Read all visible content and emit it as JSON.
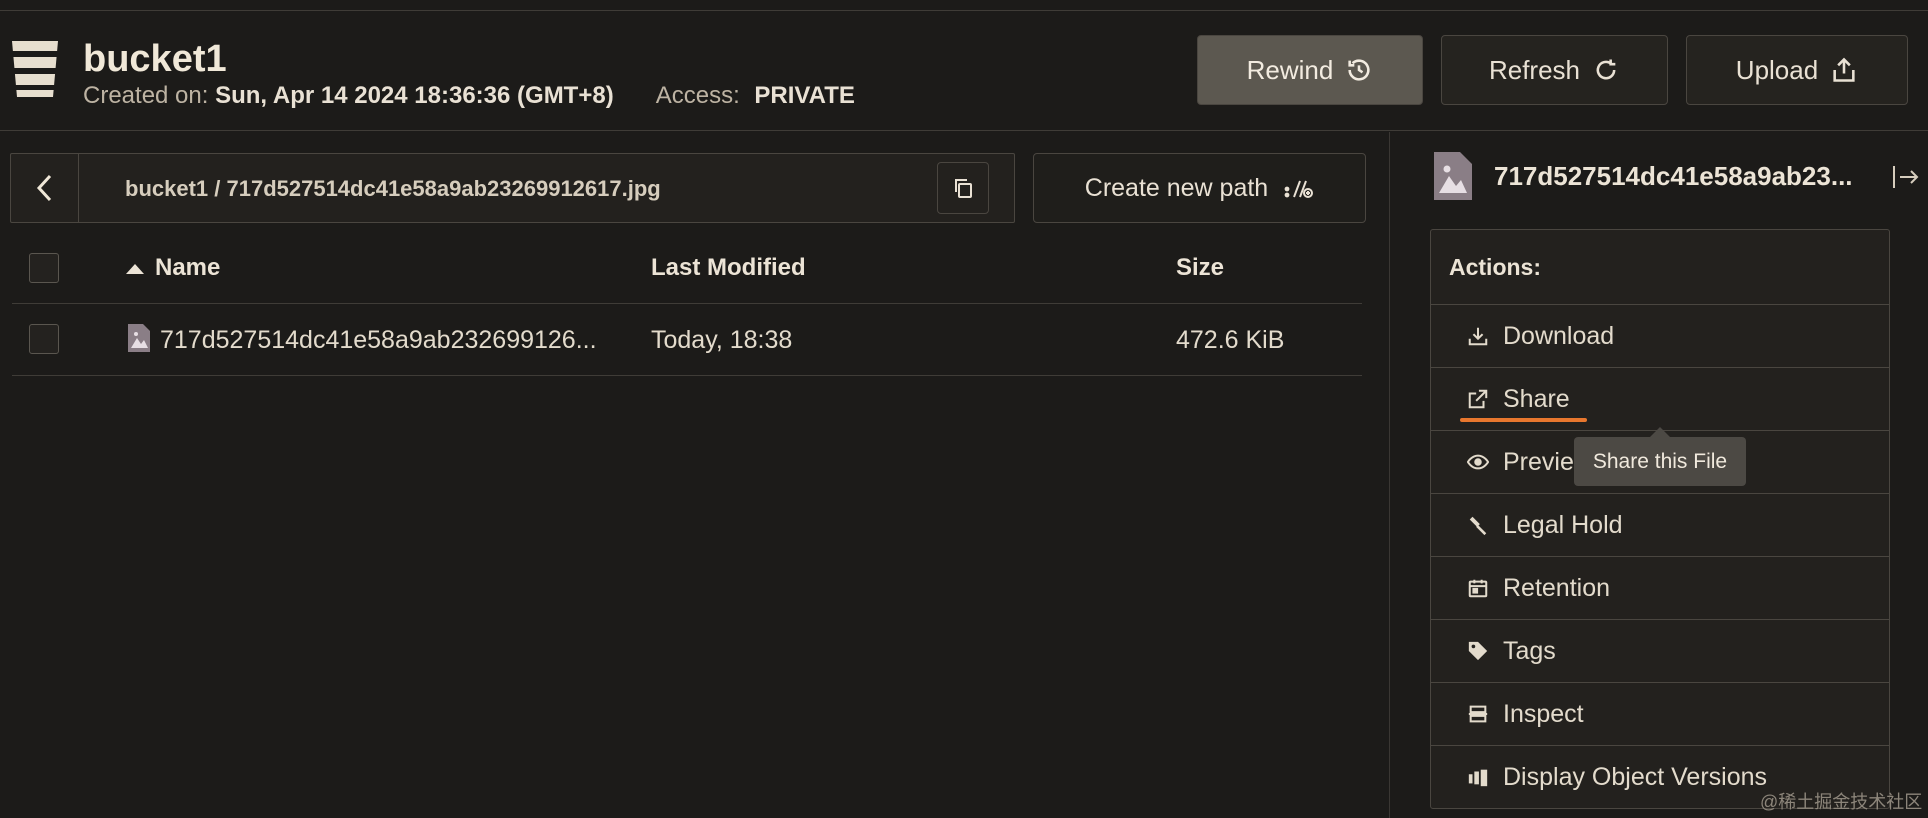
{
  "header": {
    "bucket_name": "bucket1",
    "created_label": "Created on:",
    "created_value": "Sun, Apr 14 2024 18:36:36 (GMT+8)",
    "access_label": "Access:",
    "access_value": "PRIVATE",
    "buttons": {
      "rewind": "Rewind",
      "refresh": "Refresh",
      "upload": "Upload"
    }
  },
  "breadcrumb": {
    "path": "bucket1  /  717d527514dc41e58a9ab23269912617.jpg"
  },
  "new_path_button": "Create new path",
  "table": {
    "columns": [
      "Name",
      "Last Modified",
      "Size"
    ],
    "rows": [
      {
        "name": "717d527514dc41e58a9ab232699126...",
        "last_modified": "Today, 18:38",
        "size": "472.6 KiB"
      }
    ]
  },
  "detail_panel": {
    "title": "717d527514dc41e58a9ab23...",
    "actions_title": "Actions:",
    "actions": [
      {
        "label": "Download",
        "icon": "download-icon"
      },
      {
        "label": "Share",
        "icon": "share-icon"
      },
      {
        "label": "Previe",
        "icon": "eye-icon"
      },
      {
        "label": "Legal Hold",
        "icon": "gavel-icon"
      },
      {
        "label": "Retention",
        "icon": "calendar-icon"
      },
      {
        "label": "Tags",
        "icon": "tag-icon"
      },
      {
        "label": "Inspect",
        "icon": "inspect-icon"
      },
      {
        "label": "Display Object Versions",
        "icon": "versions-icon"
      }
    ],
    "tooltip": "Share this File"
  },
  "watermark": "@稀土掘金技术社区",
  "colors": {
    "background": "#1c1b19",
    "panel": "#23211e",
    "border": "#4a4640",
    "accent_underline": "#e8772e",
    "text": "#e9e1d4"
  }
}
